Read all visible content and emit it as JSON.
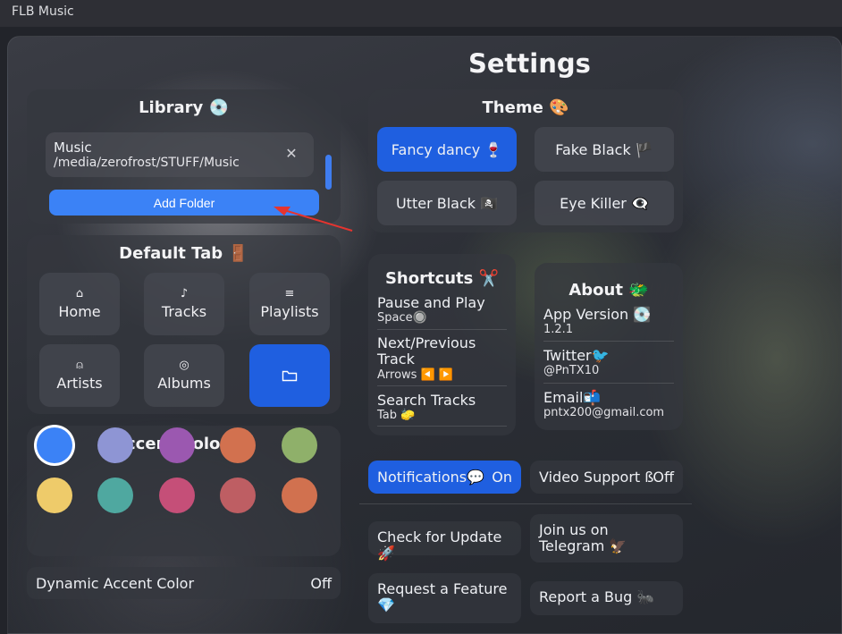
{
  "app": {
    "title": "FLB Music",
    "page_title": "Settings"
  },
  "library": {
    "title": "Library 💿",
    "folder_name": "Music",
    "folder_path": "/media/zerofrost/STUFF/Music",
    "add_folder_label": "Add Folder"
  },
  "default_tab": {
    "title": "Default Tab 🚪",
    "tabs": [
      {
        "label": "Home",
        "icon": "home-icon"
      },
      {
        "label": "Tracks",
        "icon": "music-note-icon"
      },
      {
        "label": "Playlists",
        "icon": "playlist-icon"
      },
      {
        "label": "Artists",
        "icon": "person-icon"
      },
      {
        "label": "Albums",
        "icon": "disc-icon"
      },
      {
        "label": "",
        "icon": "folder-icon",
        "selected": true
      }
    ]
  },
  "accent": {
    "title": "Accent Color 🖌️",
    "colors": [
      "#3b82f6",
      "#8e95d4",
      "#9b58b0",
      "#d2714f",
      "#8fb06a",
      "#eecb6a",
      "#4fa8a0",
      "#c54f78",
      "#be5e63",
      "#d1714f"
    ],
    "selected_index": 0,
    "dynamic_label": "Dynamic Accent Color",
    "dynamic_value": "Off"
  },
  "theme": {
    "title": "Theme 🎨",
    "options": [
      "Fancy dancy 🍷",
      "Fake Black 🏴",
      "Utter Black 🏴‍☠️",
      "Eye Killer 👁‍🗨"
    ],
    "selected_index": 0
  },
  "shortcuts": {
    "title": "Shortcuts ✂️",
    "items": [
      {
        "action": "Pause and Play",
        "key": "Space🔘"
      },
      {
        "action": "Next/Previous Track",
        "key": "Arrows ◀️ ▶️"
      },
      {
        "action": "Search Tracks",
        "key": "Tab 🧽"
      }
    ]
  },
  "about": {
    "title": "About 🐲",
    "items": [
      {
        "label": "App Version 💽",
        "value": "1.2.1"
      },
      {
        "label": "Twitter🐦",
        "value": "@PnTX10"
      },
      {
        "label": "Email📬",
        "value": "pntx200@gmail.com"
      }
    ]
  },
  "toggles": {
    "notifications_label": "Notifications💬",
    "notifications_value": "On",
    "video_label": "Video Support ß",
    "video_value": "Off"
  },
  "actions": {
    "check_update": "Check for Update 🚀",
    "telegram": "Join us on Telegram 🦅",
    "request_feature": "Request a Feature 💎",
    "report_bug": "Report a Bug 🐜"
  },
  "colors": {
    "accent": "#1f5fe0",
    "annotation_arrow": "#e5342f"
  }
}
